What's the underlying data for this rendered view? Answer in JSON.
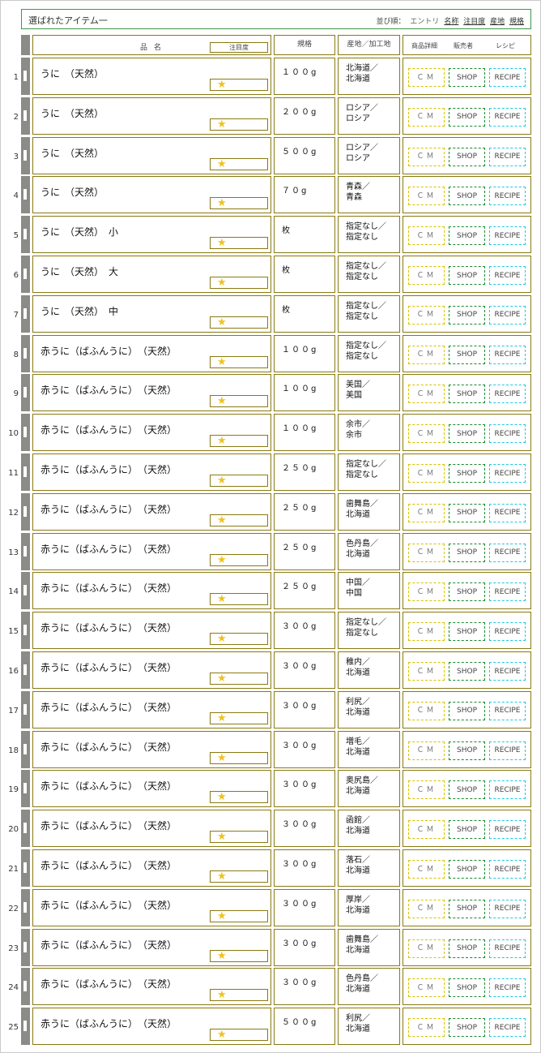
{
  "topbar": {
    "title": "選ばれたアイテム一",
    "sort_label": "並び順：",
    "sort_entry": "エントリ",
    "sort_links": [
      "名称",
      "注目度",
      "産地",
      "規格"
    ]
  },
  "header": {
    "name": "品名",
    "attention": "注目度",
    "spec": "規格",
    "origin": "産地／加工地",
    "detail": "商品詳細",
    "seller": "販売者",
    "recipe": "レシピ"
  },
  "buttons": {
    "cm": "ＣＭ",
    "shop": "SHOP",
    "recipe": "RECIPE"
  },
  "colors": {
    "cm_border": "#d9c200",
    "shop_border": "#1a8a2e",
    "recipe_border": "#22c7e0",
    "star": "#f1c21b",
    "frame_border": "#8a7a12"
  },
  "rows": [
    {
      "num": "1",
      "name": "うに　（天然）",
      "spec": "１００g",
      "origin": "北海道／\n北海道"
    },
    {
      "num": "2",
      "name": "うに　（天然）",
      "spec": "２００g",
      "origin": "ロシア／\nロシア"
    },
    {
      "num": "3",
      "name": "うに　（天然）",
      "spec": "５００g",
      "origin": "ロシア／\nロシア"
    },
    {
      "num": "4",
      "name": "うに　（天然）",
      "spec": "７０g",
      "origin": "青森／\n青森"
    },
    {
      "num": "5",
      "name": "うに　（天然）　小",
      "spec": "枚",
      "origin": "指定なし／\n指定なし"
    },
    {
      "num": "6",
      "name": "うに　（天然）　大",
      "spec": "枚",
      "origin": "指定なし／\n指定なし"
    },
    {
      "num": "7",
      "name": "うに　（天然）　中",
      "spec": "枚",
      "origin": "指定なし／\n指定なし"
    },
    {
      "num": "8",
      "name": "赤うに（ばふんうに）　（天然）",
      "spec": "１００g",
      "origin": "指定なし／\n指定なし"
    },
    {
      "num": "9",
      "name": "赤うに（ばふんうに）　（天然）",
      "spec": "１００g",
      "origin": "美国／\n美国"
    },
    {
      "num": "10",
      "name": "赤うに（ばふんうに）　（天然）",
      "spec": "１００g",
      "origin": "余市／\n余市"
    },
    {
      "num": "11",
      "name": "赤うに（ばふんうに）　（天然）",
      "spec": "２５０g",
      "origin": "指定なし／\n指定なし"
    },
    {
      "num": "12",
      "name": "赤うに（ばふんうに）　（天然）",
      "spec": "２５０g",
      "origin": "歯舞島／\n北海道"
    },
    {
      "num": "13",
      "name": "赤うに（ばふんうに）　（天然）",
      "spec": "２５０g",
      "origin": "色丹島／\n北海道"
    },
    {
      "num": "14",
      "name": "赤うに（ばふんうに）　（天然）",
      "spec": "２５０g",
      "origin": "中国／\n中国"
    },
    {
      "num": "15",
      "name": "赤うに（ばふんうに）　（天然）",
      "spec": "３００g",
      "origin": "指定なし／\n指定なし"
    },
    {
      "num": "16",
      "name": "赤うに（ばふんうに）　（天然）",
      "spec": "３００g",
      "origin": "稚内／\n北海道"
    },
    {
      "num": "17",
      "name": "赤うに（ばふんうに）　（天然）",
      "spec": "３００g",
      "origin": "利尻／\n北海道"
    },
    {
      "num": "18",
      "name": "赤うに（ばふんうに）　（天然）",
      "spec": "３００g",
      "origin": "増毛／\n北海道"
    },
    {
      "num": "19",
      "name": "赤うに（ばふんうに）　（天然）",
      "spec": "３００g",
      "origin": "奥尻島／\n北海道"
    },
    {
      "num": "20",
      "name": "赤うに（ばふんうに）　（天然）",
      "spec": "３００g",
      "origin": "函館／\n北海道"
    },
    {
      "num": "21",
      "name": "赤うに（ばふんうに）　（天然）",
      "spec": "３００g",
      "origin": "落石／\n北海道"
    },
    {
      "num": "22",
      "name": "赤うに（ばふんうに）　（天然）",
      "spec": "３００g",
      "origin": "厚岸／\n北海道"
    },
    {
      "num": "23",
      "name": "赤うに（ばふんうに）　（天然）",
      "spec": "３００g",
      "origin": "歯舞島／\n北海道"
    },
    {
      "num": "24",
      "name": "赤うに（ばふんうに）　（天然）",
      "spec": "３００g",
      "origin": "色丹島／\n北海道"
    },
    {
      "num": "25",
      "name": "赤うに（ばふんうに）　（天然）",
      "spec": "５００g",
      "origin": "利尻／\n北海道"
    }
  ]
}
